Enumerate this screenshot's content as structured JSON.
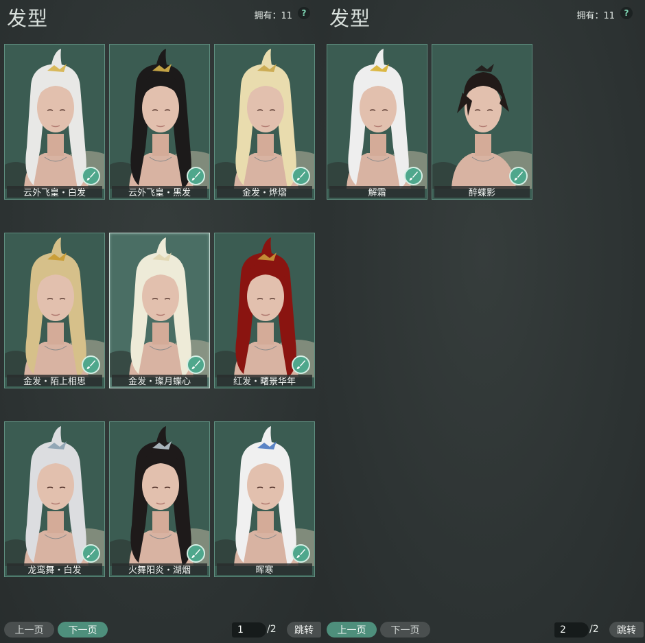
{
  "panels": [
    {
      "title": "发型",
      "owned_label": "拥有：11",
      "help_label": "?",
      "prev_label": "上一页",
      "next_label": "下一页",
      "page_value": "1",
      "page_total": "/2",
      "jump_label": "跳转",
      "cards": [
        {
          "name": "云外飞皇・白发",
          "hair_color": "#e8e8e6",
          "ornament": "#d6b24a"
        },
        {
          "name": "云外飞皇・黑发",
          "hair_color": "#1c1a1a",
          "ornament": "#d6b24a"
        },
        {
          "name": "金发・烨熠",
          "hair_color": "#e9dcae",
          "ornament": "#c9a64a"
        },
        {
          "name": "金发・陌上相思",
          "hair_color": "#d6c08a",
          "ornament": "#c99a30"
        },
        {
          "name": "金发・璨月蝶心",
          "hair_color": "#eeebd8",
          "ornament": "#e0d6b0"
        },
        {
          "name": "红发・曙景华年",
          "hair_color": "#8a1410",
          "ornament": "#c9983a"
        },
        {
          "name": "龙鸾舞・白发",
          "hair_color": "#dcdde0",
          "ornament": "#8aa0b0"
        },
        {
          "name": "火舞阳炎・湖烟",
          "hair_color": "#1e1a1a",
          "ornament": "#b8c4cc"
        },
        {
          "name": "晖寒",
          "hair_color": "#f0f0f0",
          "ornament": "#4a78c0"
        }
      ]
    },
    {
      "title": "发型",
      "owned_label": "拥有：11",
      "help_label": "?",
      "prev_label": "上一页",
      "next_label": "下一页",
      "page_value": "2",
      "page_total": "/2",
      "jump_label": "跳转",
      "cards": [
        {
          "name": "解霜",
          "hair_color": "#eeeeee",
          "ornament": "#d8b030"
        },
        {
          "name": "醉蝶影",
          "hair_color": "#221a18",
          "ornament": "#221a18"
        }
      ]
    }
  ],
  "colors": {
    "card_bg": "#3b5c52",
    "card_border": "#5f8f80",
    "badge": "#4fa78c",
    "active_button": "#4e8f7c",
    "disabled_button": "#4a4f4f"
  }
}
